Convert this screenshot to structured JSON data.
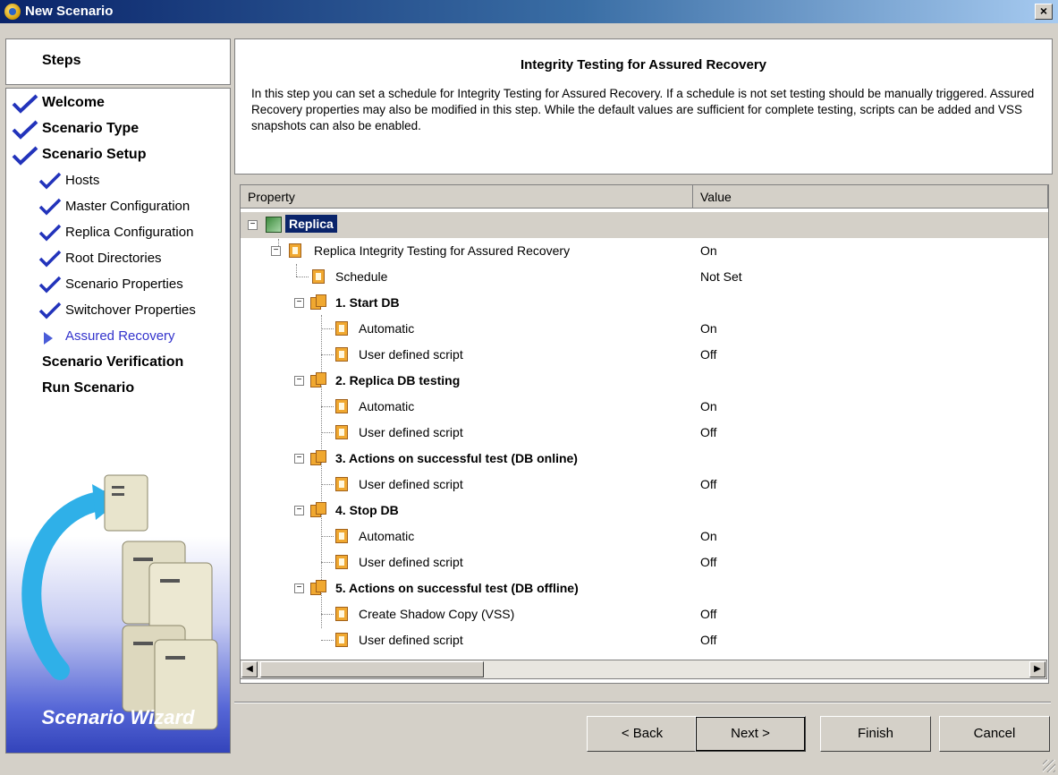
{
  "window": {
    "title": "New Scenario",
    "close_label": "×"
  },
  "steps": {
    "header": "Steps",
    "items": [
      {
        "label": "Welcome",
        "level": "top",
        "done": true
      },
      {
        "label": "Scenario Type",
        "level": "top",
        "done": true
      },
      {
        "label": "Scenario Setup",
        "level": "top",
        "done": true
      },
      {
        "label": "Hosts",
        "level": "sub",
        "done": true
      },
      {
        "label": "Master Configuration",
        "level": "sub",
        "done": true
      },
      {
        "label": "Replica Configuration",
        "level": "sub",
        "done": true
      },
      {
        "label": "Root Directories",
        "level": "sub",
        "done": true
      },
      {
        "label": "Scenario Properties",
        "level": "sub",
        "done": true
      },
      {
        "label": "Switchover Properties",
        "level": "sub",
        "done": true
      },
      {
        "label": "Assured Recovery",
        "level": "sub",
        "current": true
      },
      {
        "label": "Scenario Verification",
        "level": "top"
      },
      {
        "label": "Run Scenario",
        "level": "top"
      }
    ],
    "wizard_label": "Scenario Wizard"
  },
  "main": {
    "title": "Integrity Testing for Assured Recovery",
    "description": "In this step you can set a schedule for Integrity Testing for Assured Recovery. If a schedule is not set testing should be manually triggered. Assured Recovery properties may also be modified in this step. While the default values are sufficient for complete testing, scripts can be added and VSS snapshots can also be enabled."
  },
  "grid": {
    "columns": {
      "property": "Property",
      "value": "Value"
    },
    "rows": [
      {
        "name": "Replica",
        "value": ""
      },
      {
        "name": "Replica Integrity Testing for Assured Recovery",
        "value": "On"
      },
      {
        "name": "Schedule",
        "value": "Not Set"
      },
      {
        "name": "1. Start DB",
        "value": ""
      },
      {
        "name": "Automatic",
        "value": "On"
      },
      {
        "name": "User defined script",
        "value": "Off"
      },
      {
        "name": "2. Replica DB testing",
        "value": ""
      },
      {
        "name": "Automatic",
        "value": "On"
      },
      {
        "name": "User defined script",
        "value": "Off"
      },
      {
        "name": "3. Actions on successful test (DB online)",
        "value": ""
      },
      {
        "name": "User defined script",
        "value": "Off"
      },
      {
        "name": "4. Stop DB",
        "value": ""
      },
      {
        "name": "Automatic",
        "value": "On"
      },
      {
        "name": "User defined script",
        "value": "Off"
      },
      {
        "name": "5. Actions on successful test (DB offline)",
        "value": ""
      },
      {
        "name": "Create Shadow Copy (VSS)",
        "value": "Off"
      },
      {
        "name": "User defined script",
        "value": "Off"
      }
    ]
  },
  "buttons": {
    "back": "< Back",
    "next": "Next >",
    "finish": "Finish",
    "cancel": "Cancel"
  },
  "colors": {
    "selected_row": "#0a246a",
    "current_step": "#3333cc",
    "check": "#2233bb"
  }
}
